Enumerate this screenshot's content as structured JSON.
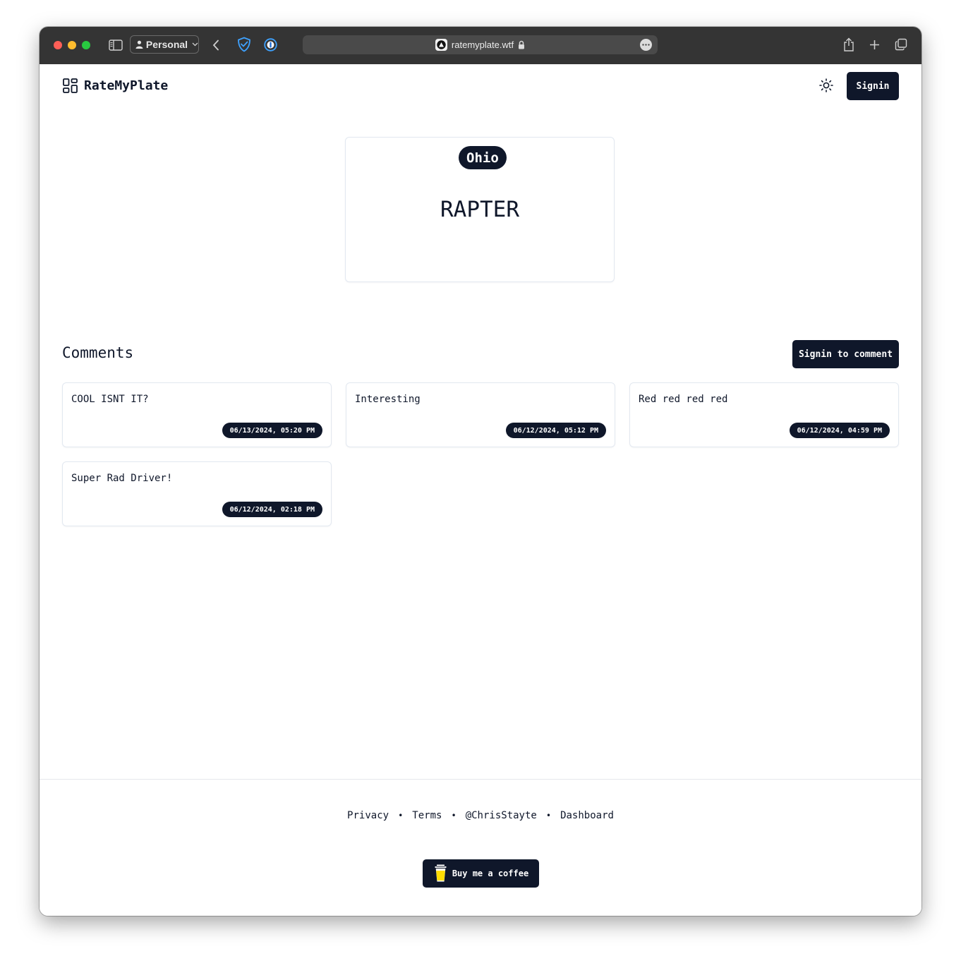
{
  "browser": {
    "profile_label": "Personal",
    "url": "ratemyplate.wtf"
  },
  "header": {
    "logo_text": "RateMyPlate",
    "signin_label": "Signin"
  },
  "plate": {
    "state": "Ohio",
    "text": "RAPTER"
  },
  "comments": {
    "title": "Comments",
    "signin_to_comment_label": "Signin to comment",
    "items": [
      {
        "text": "COOL ISNT IT?",
        "date": "06/13/2024, 05:20 PM"
      },
      {
        "text": "Interesting",
        "date": "06/12/2024, 05:12 PM"
      },
      {
        "text": "Red red red red",
        "date": "06/12/2024, 04:59 PM"
      },
      {
        "text": "Super Rad Driver!",
        "date": "06/12/2024, 02:18 PM"
      }
    ]
  },
  "footer": {
    "links": [
      "Privacy",
      "Terms",
      "@ChrisStayte",
      "Dashboard"
    ],
    "separator": "•",
    "coffee_label": "Buy me a coffee"
  },
  "colors": {
    "primary_dark": "#0f172a",
    "border": "#e2e8f0"
  }
}
